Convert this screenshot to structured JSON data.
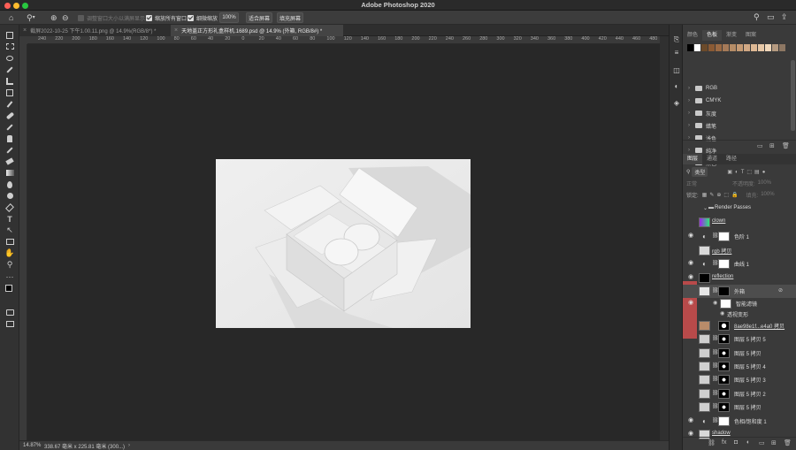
{
  "window": {
    "title": "Adobe Photoshop 2020"
  },
  "options_bar": {
    "resize_windows_label": "调整窗口大小以满屏显示",
    "zoom_all_label": "缩放所有窗口",
    "scrubby_zoom_label": "细微缩放",
    "zoom_value": "100%",
    "fit_screen_label": "适合屏幕",
    "fill_screen_label": "填充屏幕"
  },
  "tabs": [
    {
      "label": "截屏2022-10-25 下午1.00.11.png @ 14.9%(RGB/8*) *"
    },
    {
      "label": "天地盖正方形礼盒样机.1689.psd @ 14.9% (外箱, RGB/8#) *"
    }
  ],
  "ruler": {
    "ticks": [
      "240",
      "220",
      "200",
      "180",
      "160",
      "140",
      "120",
      "100",
      "80",
      "60",
      "40",
      "20",
      "0",
      "20",
      "40",
      "60",
      "80",
      "100",
      "120",
      "140",
      "160",
      "180",
      "200",
      "220",
      "240",
      "260",
      "280",
      "300",
      "320",
      "340",
      "360",
      "380",
      "400",
      "420",
      "440",
      "460",
      "480"
    ]
  },
  "status": {
    "zoom": "14.87%",
    "doc_info": "338.67 毫米 x 225.81 毫米 (300...)"
  },
  "swatches_panel": {
    "tabs": [
      "颜色",
      "色板",
      "渐变",
      "图案"
    ],
    "active_tab": "色板",
    "swatch_colors": [
      "#000000",
      "#ffffff",
      "#6b4a2a",
      "#8a5a34",
      "#9b6a44",
      "#a57a58",
      "#b58c66",
      "#c49a74",
      "#d0a884",
      "#ddb894",
      "#e6c7a6",
      "#f0d7ba",
      "#b59a80",
      "#8d7763"
    ],
    "folders": [
      "RGB",
      "CMYK",
      "灰度",
      "蜡笔",
      "浅色",
      "纯净",
      "黑色"
    ]
  },
  "layers_panel": {
    "tabs": [
      "图层",
      "通道",
      "路径"
    ],
    "active_tab": "图层",
    "filter_kind": "类型",
    "blend_mode": "正常",
    "opacity_label": "不透明度:",
    "opacity_value": "100%",
    "lock_label": "锁定:",
    "fill_label": "填充:",
    "fill_value": "100%",
    "layers": [
      {
        "name": "Render Passes",
        "kind": "group"
      },
      {
        "name": "clown",
        "kind": "raster"
      },
      {
        "name": "色阶 1",
        "kind": "adjustment"
      },
      {
        "name": "rgb 拷贝",
        "kind": "raster"
      },
      {
        "name": "曲线 1",
        "kind": "adjustment"
      },
      {
        "name": "reflection",
        "kind": "raster"
      },
      {
        "name": "外箱",
        "kind": "smart",
        "selected": true
      },
      {
        "name": "智能滤镜",
        "kind": "filter-group"
      },
      {
        "name": "透视变形",
        "kind": "filter"
      },
      {
        "name": "8ae98e1f...e4a0 拷贝",
        "kind": "raster"
      },
      {
        "name": "图层 5 拷贝 5",
        "kind": "masked"
      },
      {
        "name": "图层 5 拷贝",
        "kind": "masked"
      },
      {
        "name": "图层 5 拷贝 4",
        "kind": "masked"
      },
      {
        "name": "图层 5 拷贝 3",
        "kind": "masked"
      },
      {
        "name": "图层 5 拷贝 2",
        "kind": "masked"
      },
      {
        "name": "图层 5 拷贝",
        "kind": "masked"
      },
      {
        "name": "色相/饱和度 1",
        "kind": "adjustment"
      },
      {
        "name": "shadow",
        "kind": "raster"
      }
    ]
  }
}
